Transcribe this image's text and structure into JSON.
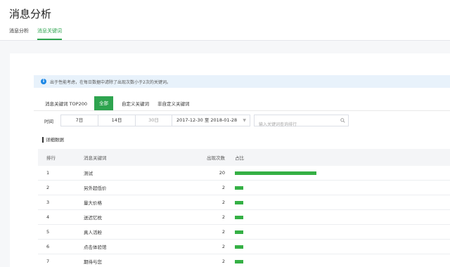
{
  "header": {
    "title": "消息分析",
    "tabs": [
      {
        "label": "消息分析",
        "active": false
      },
      {
        "label": "消息关键词",
        "active": true
      }
    ]
  },
  "notice": {
    "icon": "info-icon",
    "text": "出于性能考虑，在每日数据中滤除了出现次数小于2次的关键词。"
  },
  "filter_tabs": [
    {
      "label": "消息关键词 TOP200",
      "active": false
    },
    {
      "label": "全部",
      "active": true
    },
    {
      "label": "自定义关键词",
      "active": false
    },
    {
      "label": "非自定义关键词",
      "active": false
    }
  ],
  "time_filter": {
    "label": "时间",
    "options": [
      "7日",
      "14日",
      "30日"
    ],
    "date_range": "2017-12-30 至 2018-01-28",
    "search_placeholder": "输入关键词查询排行"
  },
  "section_title": "详细数据",
  "table": {
    "headers": {
      "rank": "排行",
      "keyword": "消息关键词",
      "count": "出现次数",
      "ratio": "占比"
    },
    "max_count": 20,
    "rows": [
      {
        "rank": "1",
        "keyword": "测试",
        "count": "20",
        "value": 20
      },
      {
        "rank": "2",
        "keyword": "另外超低价",
        "count": "2",
        "value": 2
      },
      {
        "rank": "3",
        "keyword": "量大价格",
        "count": "2",
        "value": 2
      },
      {
        "rank": "4",
        "keyword": "送迟忆枕",
        "count": "2",
        "value": 2
      },
      {
        "rank": "5",
        "keyword": "真人活粉",
        "count": "2",
        "value": 2
      },
      {
        "rank": "6",
        "keyword": "点击体验馆",
        "count": "2",
        "value": 2
      },
      {
        "rank": "7",
        "keyword": "期待与您",
        "count": "2",
        "value": 2
      }
    ]
  },
  "colors": {
    "accent": "#2ea44f",
    "bar": "#35b045",
    "notice_bg": "#e8f2fb",
    "info": "#1e88e5"
  }
}
